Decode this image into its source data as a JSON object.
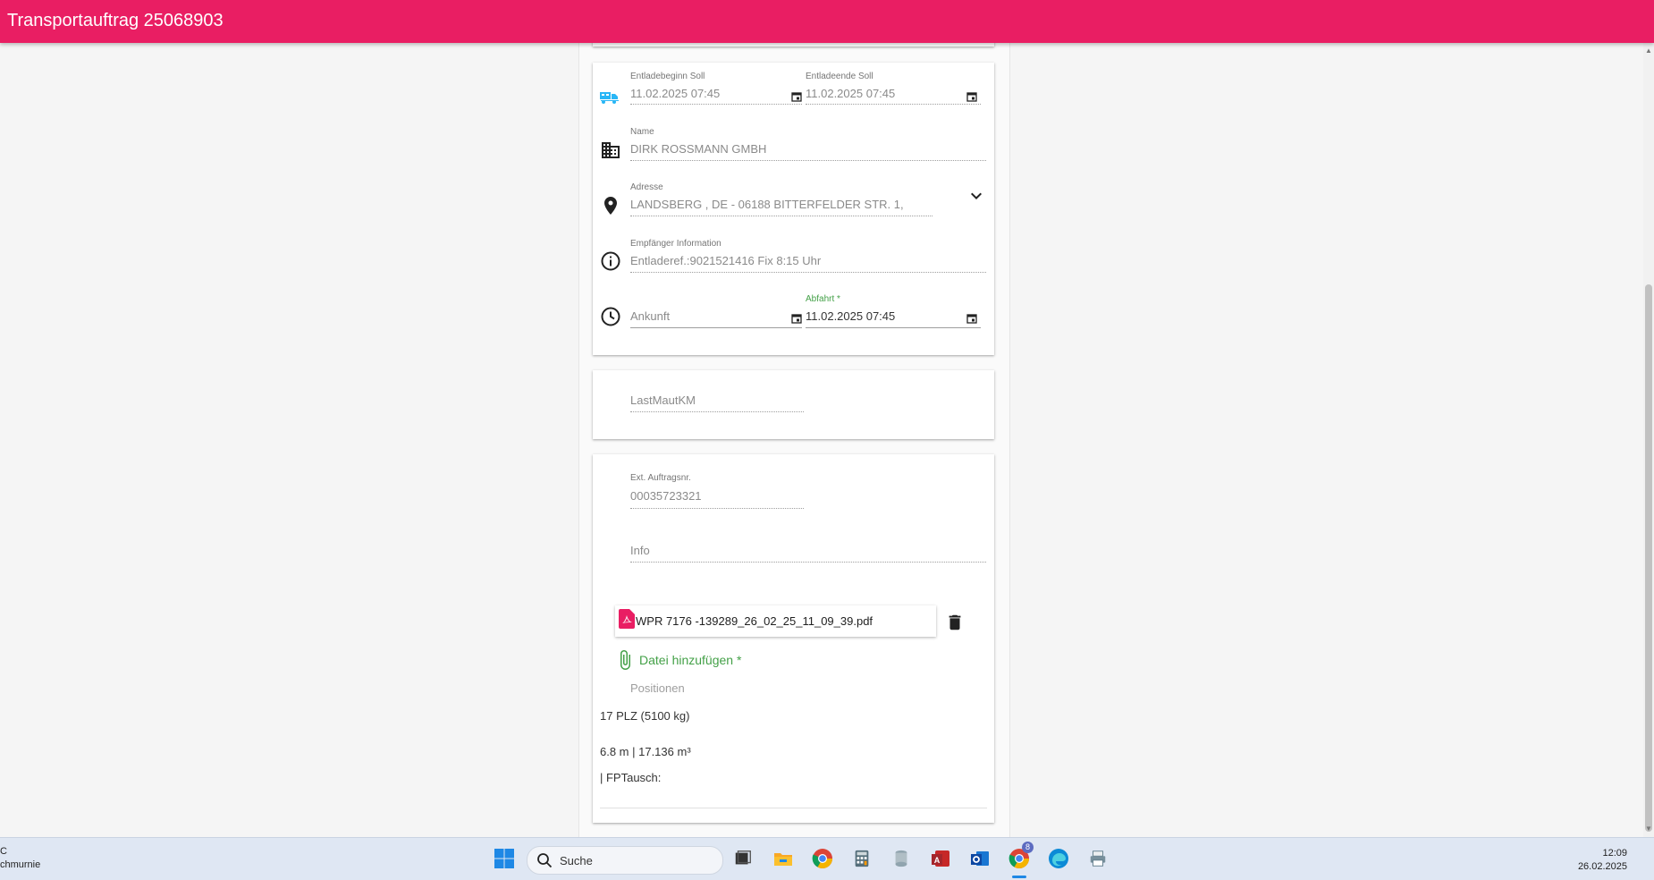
{
  "app_bar": {
    "title": "Transportauftrag 25068903"
  },
  "unloading": {
    "start_label": "Entladebeginn Soll",
    "start_value": "11.02.2025 07:45",
    "end_label": "Entladeende Soll",
    "end_value": "11.02.2025 07:45",
    "name_label": "Name",
    "name_value": "DIRK ROSSMANN GMBH",
    "address_label": "Adresse",
    "address_value": "LANDSBERG , DE - 06188 BITTERFELDER STR. 1,",
    "recipient_label": "Empfänger Information",
    "recipient_value": "Entladeref.:9021521416 Fix 8:15 Uhr",
    "arrival_placeholder": "Ankunft",
    "departure_label": "Abfahrt *",
    "departure_value": "11.02.2025 07:45"
  },
  "maut": {
    "label": "LastMautKM"
  },
  "docs": {
    "ext_order_label": "Ext. Auftragsnr.",
    "ext_order_value": "00035723321",
    "info_placeholder": "Info",
    "attachment_name": "WPR 7176 -139289_26_02_25_11_09_39.pdf",
    "add_file_label": "Datei hinzufügen *",
    "positions_label": "Positionen",
    "position_line1": "17 PLZ (5100 kg)",
    "position_line2": "6.8 m | 17.136 m³",
    "position_line3": "| FPTausch:"
  },
  "taskbar": {
    "left_line1": "C",
    "left_line2": "chmurnie",
    "search_label": "Suche",
    "chrome_badge": "8",
    "time": "12:09",
    "date": "26.02.2025"
  },
  "colors": {
    "primary": "#e91e63",
    "accent_green": "#43a047",
    "truck_blue": "#29b6f6"
  }
}
